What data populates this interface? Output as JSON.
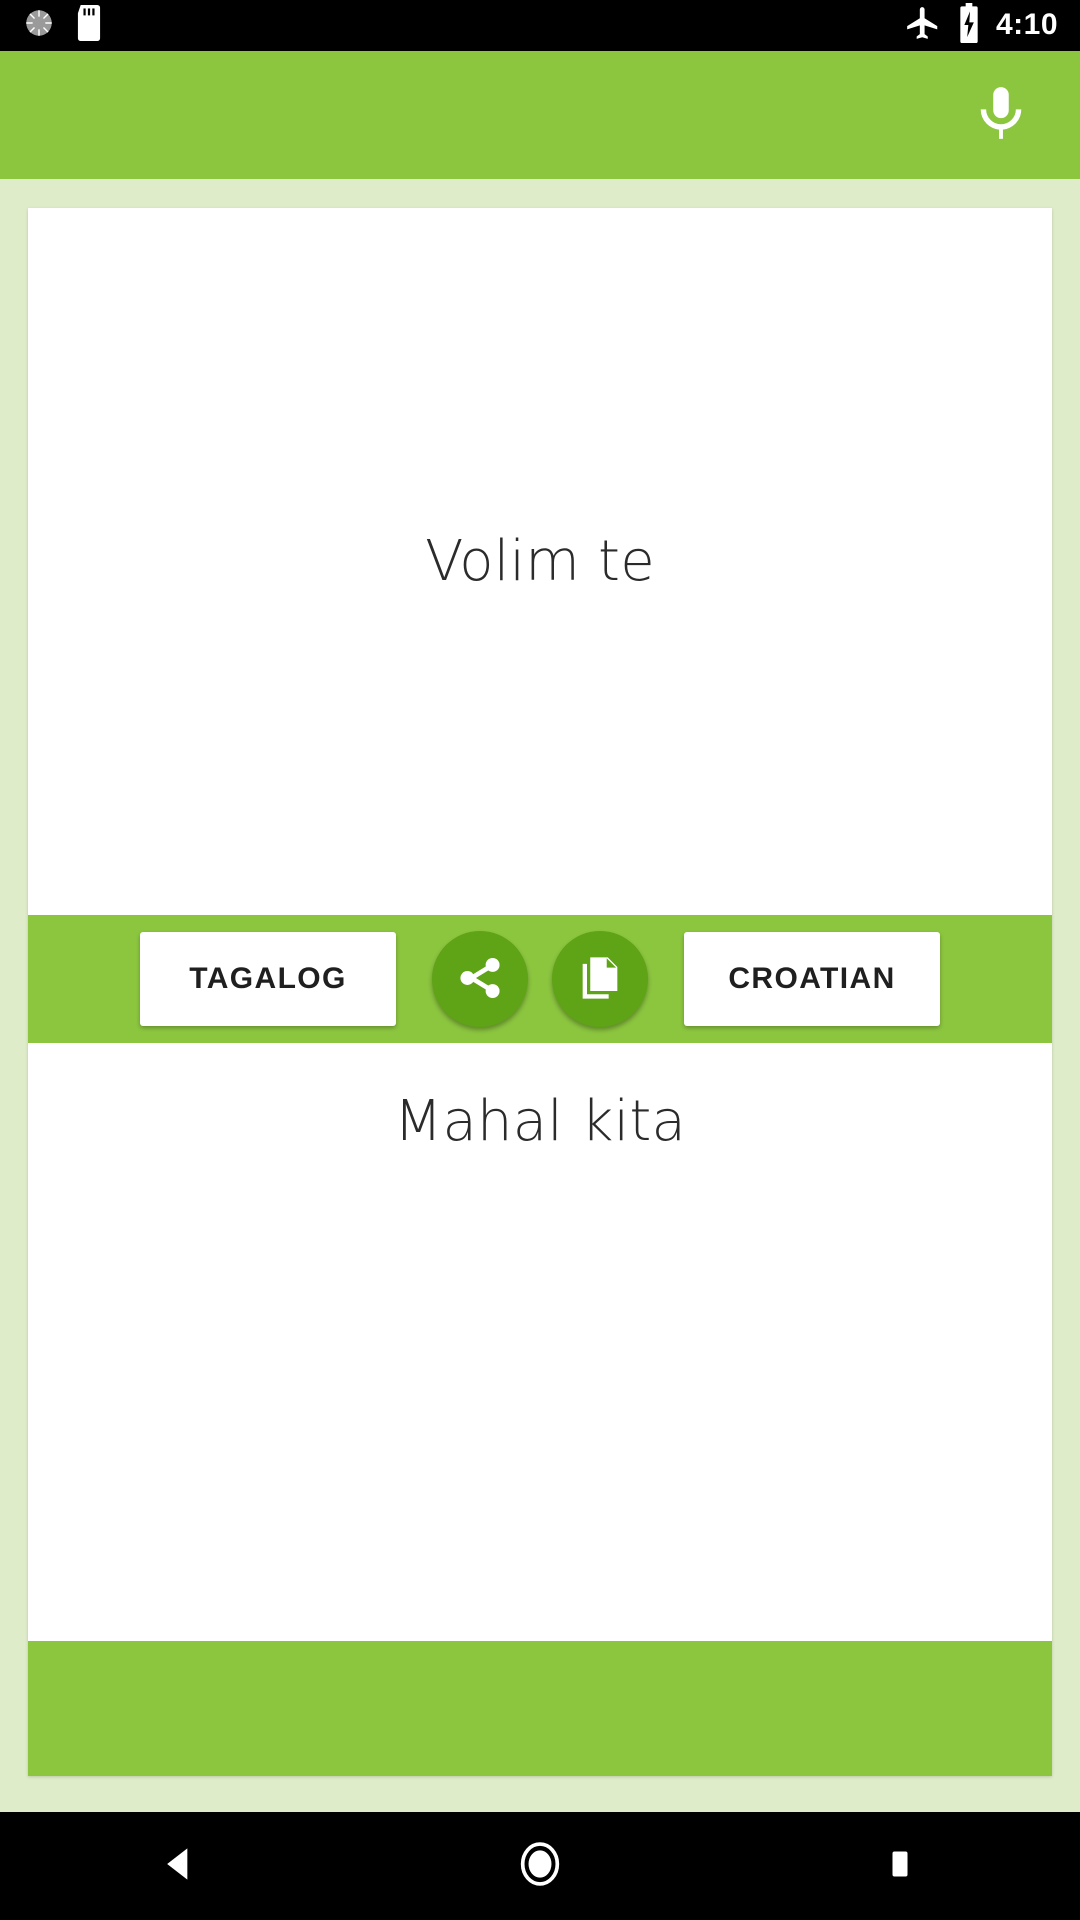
{
  "status_bar": {
    "icons_left": [
      "sync-spinner-icon",
      "sd-card-icon"
    ],
    "icons_right": [
      "airplane-mode-icon",
      "battery-charging-icon"
    ],
    "time": "4:10"
  },
  "app_bar": {
    "title": "",
    "mic_label": "microphone-icon",
    "background_color": "#8cc63f"
  },
  "translation": {
    "source_text": "Volim te",
    "target_text": "Mahal kita"
  },
  "actions": {
    "source_language_button": "TAGALOG",
    "target_language_button": "CROATIAN",
    "share_label": "share-icon",
    "copy_label": "copy-icon",
    "fab_color": "#5fa316"
  },
  "nav_bar": {
    "back": "back-button",
    "home": "home-button",
    "recents": "recents-button"
  },
  "colors": {
    "accent": "#8cc63f",
    "page_background": "#dfecc9",
    "fab": "#5fa316",
    "text": "#2b2b2b"
  }
}
